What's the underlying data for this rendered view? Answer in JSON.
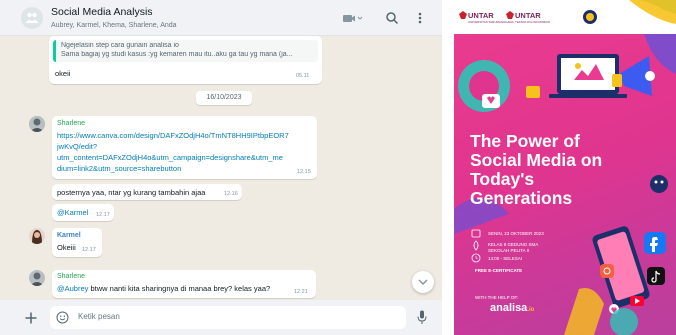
{
  "chat": {
    "header": {
      "title": "Social Media Analysis",
      "members": "Aubrey, Karmel, Khema, Sharlene, Anda"
    },
    "messages": {
      "quote_line1": "Ngejelasin step cara gunain analisa io",
      "quote_line2": "Sama bagiaj yg studi kasus :yg kemaren mau itu..aku ga tau yg mana (ja...",
      "okeii_text": "okeii",
      "okeii_time": "05.11",
      "date_divider": "16/10/2023",
      "sharlene_sender": "Sharlene",
      "link_lines": [
        "https://www.canva.com/design/DAFxZOdjH4o/TmNT8HH9IPtbpEOR7",
        "jwKvQ/edit?",
        "utm_content=DAFxZOdjH4o&utm_campaign=designshare&utm_me",
        "dium=link2&utm_source=sharebutton"
      ],
      "link_time": "12.15",
      "poster_msg": "posternya yaa, ntar yg kurang tambahin ajaa",
      "poster_time": "12.16",
      "karmel_mention": "@Karmel",
      "karmel_mention_time": "12.17",
      "karmel_sender": "Karmel",
      "karmel_text": "Okeiii",
      "karmel_time": "12.17",
      "sharlene2_sender": "Sharlene",
      "aubrey_mention": "@Aubrey",
      "aubrey_text": " btww nanti kita sharingnya di manaa brey? kelas yaa?",
      "aubrey_time": "12.21"
    },
    "composer": {
      "placeholder": "Ketik pesan"
    },
    "colors": {
      "panel_bg": "#efeae2",
      "header_bg": "#f0f2f5",
      "link": "#027eb5",
      "quote_bar": "#06cf9c",
      "sender_sharlene": "#1fa855",
      "sender_karmel": "#3b82c4"
    }
  },
  "poster": {
    "logo1": "UNTAR",
    "logo1_sub": "UNIVERSITAS TARUMANAGARA",
    "logo2": "UNTAR",
    "logo2_sub": "TEKNOLOGI INFORMASI",
    "title_lines": [
      "The Power of",
      "Social Media on",
      "Today's",
      "Generations"
    ],
    "event_date": "SENIN, 23 OKTOBER 2023",
    "event_place1": "KELAS 8 GEDUNG SMA",
    "event_place2": "SEKOLAH PELITA II",
    "event_time": "14:00 - SELESAI",
    "certificate": "FREE E-CERTIFICATE",
    "help": "WITH THE HELP OF:",
    "brand": "analisa",
    "brand_suffix": ".io",
    "colors": {
      "main_gradient_start": "#e93b8f",
      "main_gradient_end": "#b9409c",
      "accent_yellow": "#f6c21b",
      "accent_teal": "#2ec4b6",
      "accent_blue": "#3d5af1"
    }
  }
}
